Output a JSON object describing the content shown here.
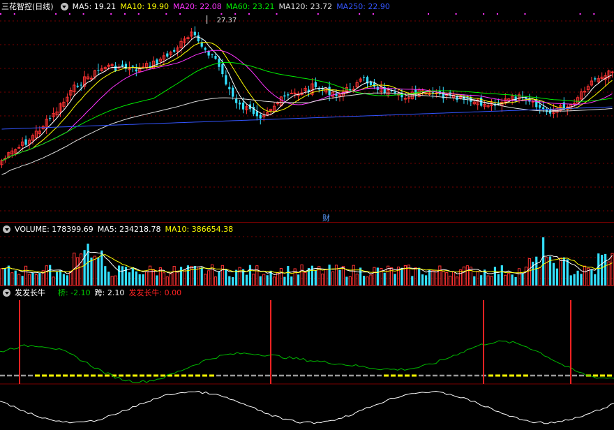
{
  "price_panel": {
    "stock_title": "三花智控(日线)",
    "ma_legend": [
      {
        "label": "MA5: 19.21",
        "color": "#ffffff"
      },
      {
        "label": "MA10: 19.90",
        "color": "#ffff00"
      },
      {
        "label": "MA20: 22.08",
        "color": "#ff33ff"
      },
      {
        "label": "MA60: 23.21",
        "color": "#00ee00"
      },
      {
        "label": "MA120: 23.72",
        "color": "#dddddd"
      },
      {
        "label": "MA250: 22.90",
        "color": "#3355ff"
      }
    ],
    "high_marker": "27.37",
    "finance_badge": "财"
  },
  "volume_panel": {
    "legend": [
      {
        "label": "VOLUME: 178399.69",
        "color": "#ffffff"
      },
      {
        "label": "MA5: 234218.78",
        "color": "#ffffff"
      },
      {
        "label": "MA10: 386654.38",
        "color": "#ffff00"
      }
    ]
  },
  "indicator_panel": {
    "name": "发发长牛",
    "legend": [
      {
        "label": "桥: -2.10",
        "color": "#00cc00"
      },
      {
        "label": "跨: 2.10",
        "color": "#ffffff"
      },
      {
        "label": "发发长牛: 0.00",
        "color": "#ff2222"
      }
    ]
  },
  "colors": {
    "up": "#ff3333",
    "down": "#33e0ff",
    "grid": "#7a0000",
    "ma5": "#ffffff",
    "ma10": "#ffff00",
    "ma20": "#ff33ff",
    "ma60": "#00ee00",
    "ma120": "#dddddd",
    "ma250": "#3355ff"
  },
  "signal_bars_x_index": [
    6,
    78,
    139,
    164
  ]
}
